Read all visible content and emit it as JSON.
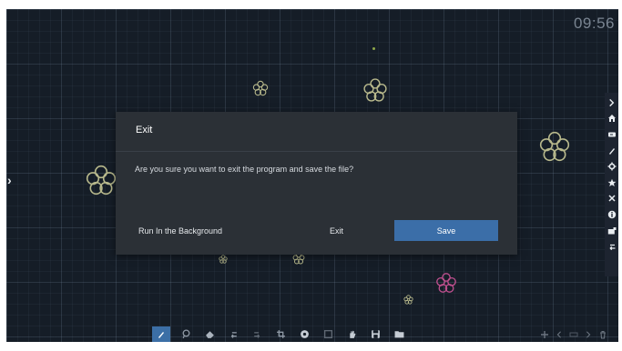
{
  "status": {
    "clock": "09:56"
  },
  "dialog": {
    "title": "Exit",
    "message": "Are you sure you want to exit the program and save the file?",
    "background_label": "Run In the Background",
    "exit_label": "Exit",
    "save_label": "Save"
  },
  "sidebar": {
    "items": [
      "chevron-right",
      "home",
      "input-source",
      "pen",
      "gear",
      "star",
      "tools",
      "info",
      "whiteboard",
      "back"
    ]
  },
  "toolbar": {
    "items": [
      "pen",
      "lasso",
      "eraser",
      "undo",
      "redo",
      "crop",
      "record",
      "select",
      "hand",
      "save",
      "folder"
    ],
    "active": "pen",
    "right_items": [
      "add",
      "prev-page",
      "page-indicator",
      "next-page",
      "delete"
    ]
  },
  "colors": {
    "canvas": "#151d27",
    "dialog": "#2b3036",
    "accent": "#3b6ea8",
    "flower_olive": "#b8b98c",
    "flower_pink": "#c0508f"
  }
}
